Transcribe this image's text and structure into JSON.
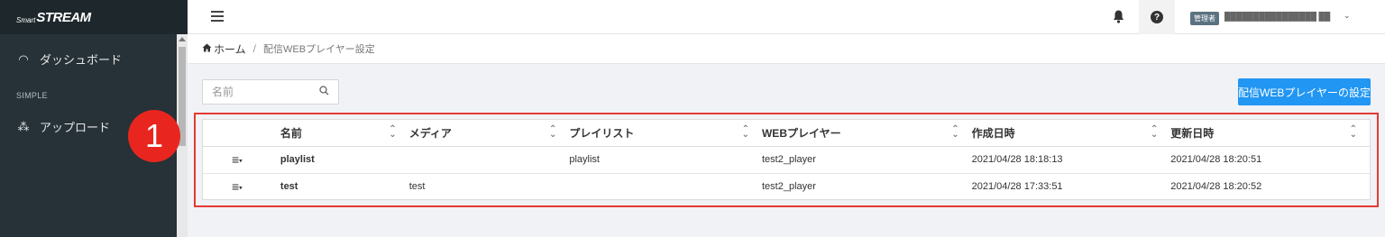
{
  "brand": {
    "small": "Smart",
    "main": "STREAM"
  },
  "sidebar": {
    "items": [
      {
        "label": "ダッシュボード",
        "icon": "dashboard-gauge-icon",
        "glyph": "◠"
      },
      {
        "label": "アップロード",
        "icon": "upload-icon",
        "glyph": "⁂"
      }
    ],
    "section": "SIMPLE"
  },
  "topbar": {
    "admin_badge": "管理者",
    "user_name": "████████████████ ██",
    "caret": "⌄"
  },
  "breadcrumb": {
    "home": "ホーム",
    "separator": "/",
    "current": "配信WEBプレイヤー設定"
  },
  "search": {
    "placeholder": "名前"
  },
  "primary_button": "配信WEBプレイヤーの設定",
  "table": {
    "columns": [
      "",
      "名前",
      "メディア",
      "プレイリスト",
      "WEBプレイヤー",
      "作成日時",
      "更新日時"
    ],
    "rows": [
      {
        "name": "playlist",
        "media": "",
        "playlist": "playlist",
        "player": "test2_player",
        "created": "2021/04/28 18:18:13",
        "updated": "2021/04/28 18:20:51"
      },
      {
        "name": "test",
        "media": "test",
        "playlist": "",
        "player": "test2_player",
        "created": "2021/04/28 17:33:51",
        "updated": "2021/04/28 18:20:52"
      }
    ]
  },
  "annotation": {
    "number": "1",
    "color": "#e53935"
  },
  "colors": {
    "sidebar": "#263238",
    "primary": "#2196f3",
    "annotation": "#e53935"
  }
}
